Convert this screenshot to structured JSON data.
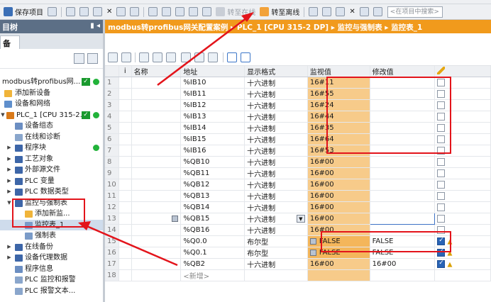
{
  "toolbar": {
    "save_label": "保存项目",
    "go_online_label": "转至在线",
    "go_offline_label": "转至离线",
    "search_placeholder": "<在项目中搜索>"
  },
  "left_panel": {
    "title": "目树",
    "tab_label": "备",
    "tree": [
      {
        "label": "modbus转profibus网...",
        "status": "ok"
      },
      {
        "label": "添加新设备"
      },
      {
        "label": "设备和网络"
      },
      {
        "label": "PLC_1 [CPU 315-2...",
        "status": "ok"
      },
      {
        "label": "设备组态"
      },
      {
        "label": "在线和诊断"
      },
      {
        "label": "程序块"
      },
      {
        "label": "工艺对象"
      },
      {
        "label": "外部源文件"
      },
      {
        "label": "PLC 变量"
      },
      {
        "label": "PLC 数据类型"
      },
      {
        "label": "监控与强制表"
      },
      {
        "label": "添加新监..."
      },
      {
        "label": "监控表_1"
      },
      {
        "label": "强制表"
      },
      {
        "label": "在线备份"
      },
      {
        "label": "设备代理数据"
      },
      {
        "label": "程序信息"
      },
      {
        "label": "PLC 监控和报警"
      },
      {
        "label": "PLC 报警文本..."
      }
    ]
  },
  "breadcrumb": {
    "text": "modbus转profibus网关配置案例 ▸ PLC_1 [CPU 315-2 DP] ▸ 监控与强制表 ▸ 监控表_1"
  },
  "watch_table": {
    "columns": [
      "i",
      "名称",
      "地址",
      "显示格式",
      "监视值",
      "修改值"
    ],
    "rows": [
      {
        "n": "1",
        "address": "%IB10",
        "format": "十六进制",
        "monitor": "16#11",
        "modify": ""
      },
      {
        "n": "2",
        "address": "%IB11",
        "format": "十六进制",
        "monitor": "16#55",
        "modify": ""
      },
      {
        "n": "3",
        "address": "%IB12",
        "format": "十六进制",
        "monitor": "16#24",
        "modify": ""
      },
      {
        "n": "4",
        "address": "%IB13",
        "format": "十六进制",
        "monitor": "16#44",
        "modify": ""
      },
      {
        "n": "5",
        "address": "%IB14",
        "format": "十六进制",
        "monitor": "16#35",
        "modify": ""
      },
      {
        "n": "6",
        "address": "%IB15",
        "format": "十六进制",
        "monitor": "16#64",
        "modify": ""
      },
      {
        "n": "7",
        "address": "%IB16",
        "format": "十六进制",
        "monitor": "16#53",
        "modify": ""
      },
      {
        "n": "8",
        "address": "%QB10",
        "format": "十六进制",
        "monitor": "16#00",
        "modify": ""
      },
      {
        "n": "9",
        "address": "%QB11",
        "format": "十六进制",
        "monitor": "16#00",
        "modify": ""
      },
      {
        "n": "10",
        "address": "%QB12",
        "format": "十六进制",
        "monitor": "16#00",
        "modify": ""
      },
      {
        "n": "11",
        "address": "%QB13",
        "format": "十六进制",
        "monitor": "16#00",
        "modify": ""
      },
      {
        "n": "12",
        "address": "%QB14",
        "format": "十六进制",
        "monitor": "16#00",
        "modify": ""
      },
      {
        "n": "13",
        "address": "%QB15",
        "format": "十六进制",
        "monitor": "16#00",
        "modify": ""
      },
      {
        "n": "14",
        "address": "%QB16",
        "format": "十六进制",
        "monitor": "16#00",
        "modify": ""
      },
      {
        "n": "15",
        "address": "%Q0.0",
        "format": "布尔型",
        "monitor": "FALSE",
        "modify": "FALSE"
      },
      {
        "n": "16",
        "address": "%Q0.1",
        "format": "布尔型",
        "monitor": "FALSE",
        "modify": "FALSE"
      },
      {
        "n": "17",
        "address": "%QB2",
        "format": "十六进制",
        "monitor": "16#00",
        "modify": "16#00"
      },
      {
        "n": "18",
        "address": "<新增>",
        "format": "",
        "monitor": "",
        "modify": ""
      }
    ]
  },
  "colors": {
    "breadcrumb_bg": "#f19a1c",
    "monitor_bg": "#f7cb8a",
    "annotation_red": "#e3141b",
    "status_green": "#1a9a2e"
  }
}
